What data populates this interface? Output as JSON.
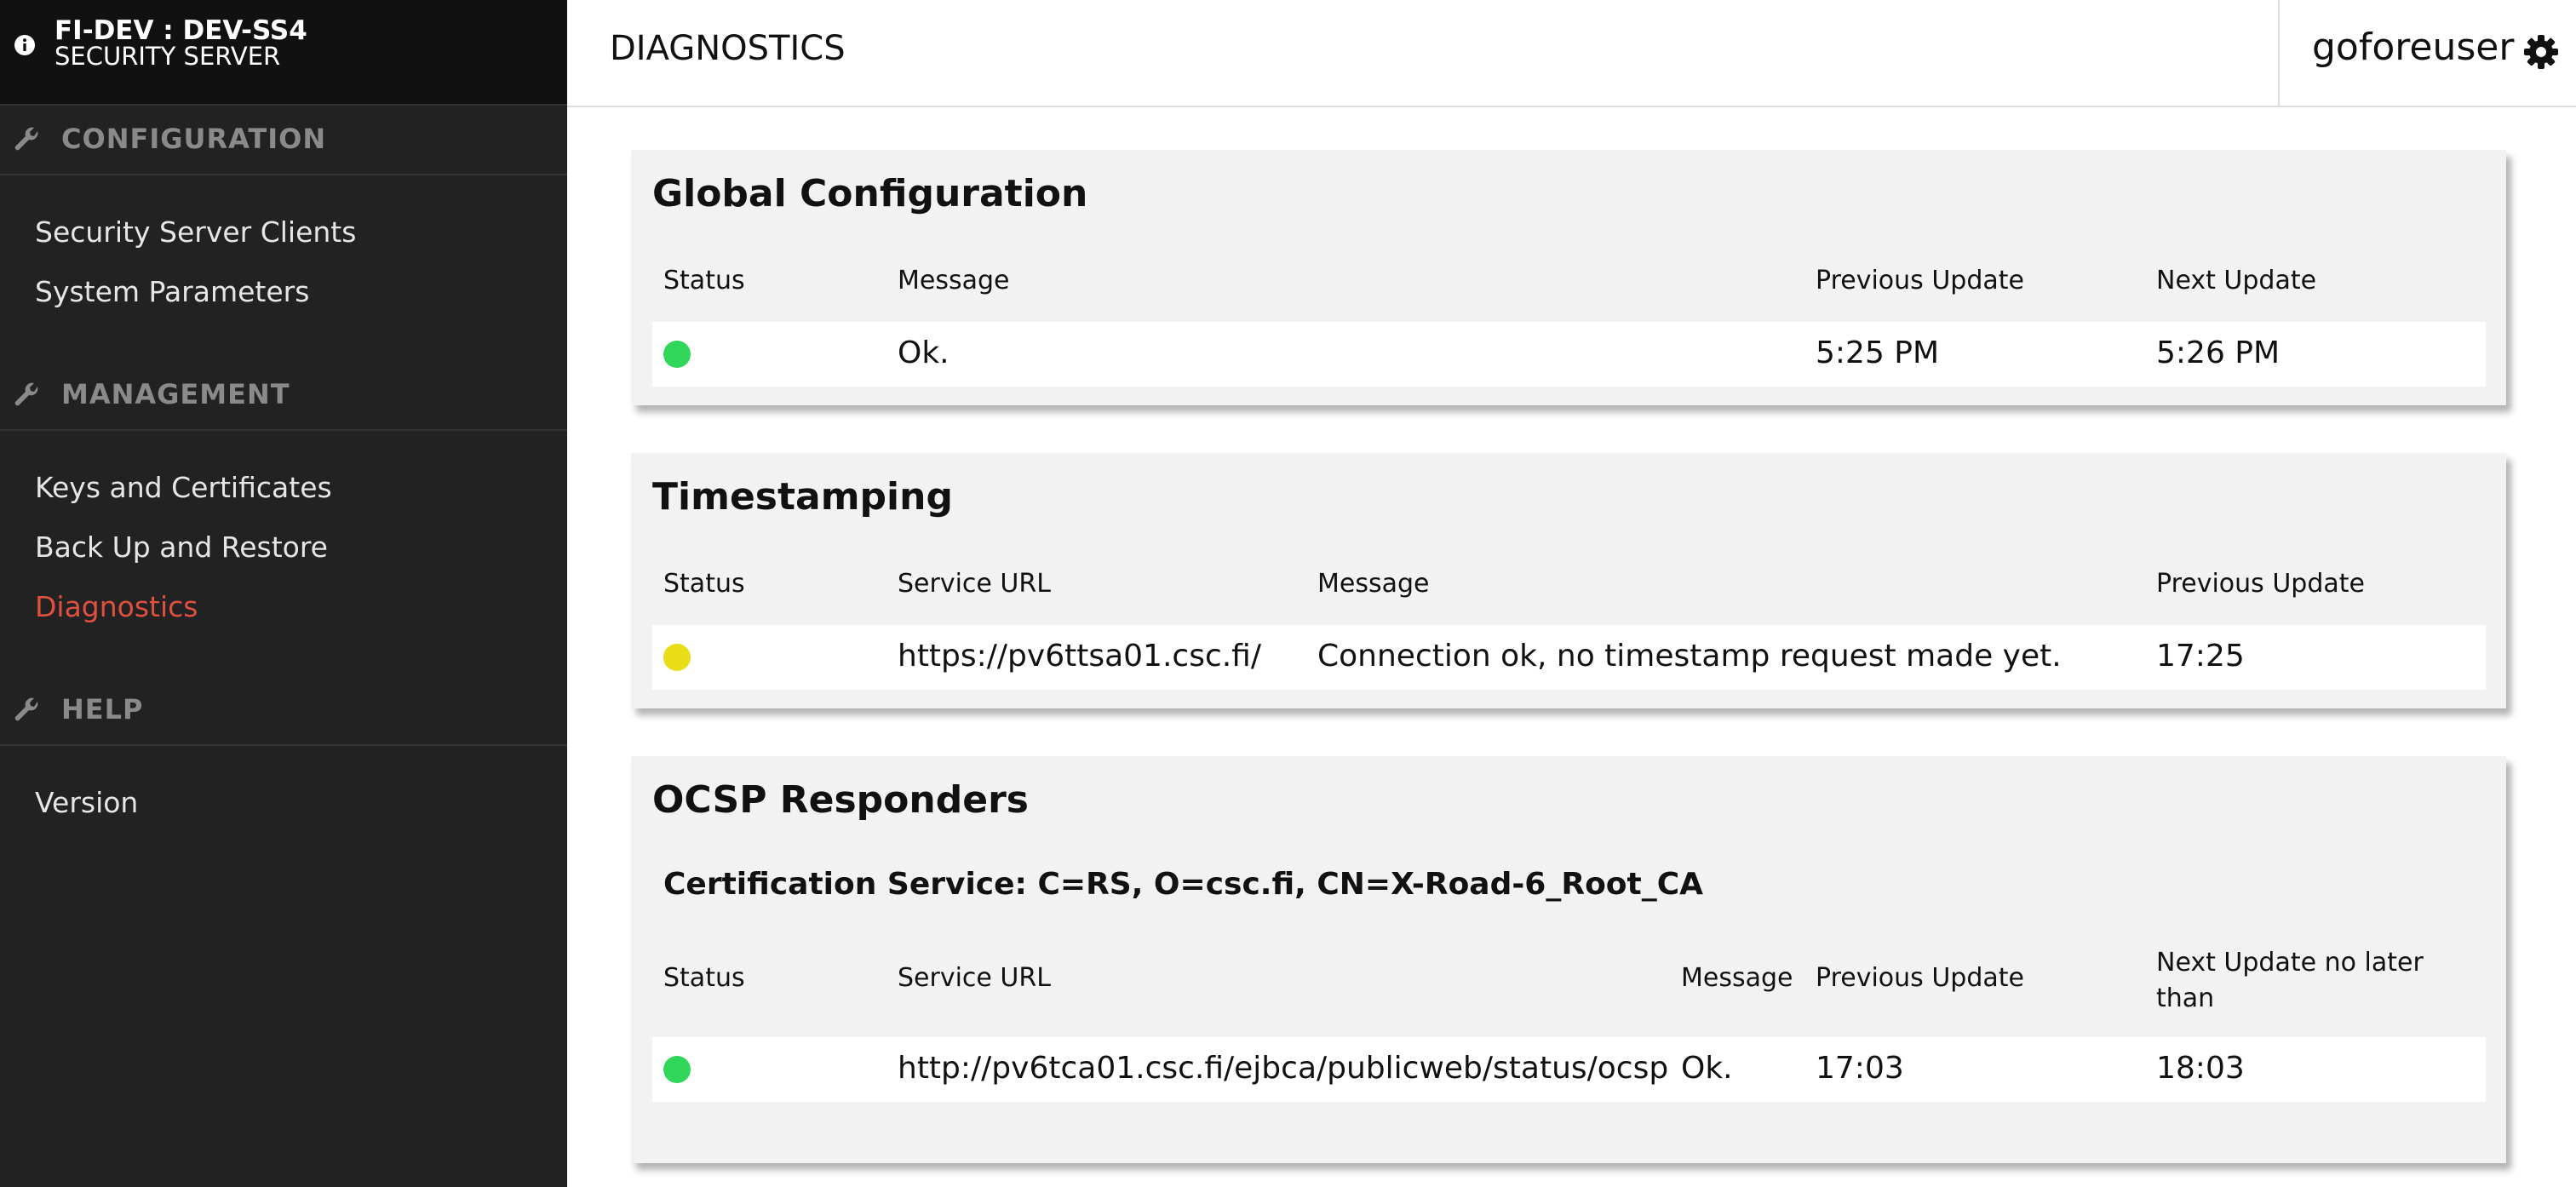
{
  "brand": {
    "line1": "FI-DEV : DEV-SS4",
    "line2": "SECURITY SERVER"
  },
  "sidebar": {
    "sections": [
      {
        "title": "CONFIGURATION",
        "items": [
          "Security Server Clients",
          "System Parameters"
        ]
      },
      {
        "title": "MANAGEMENT",
        "items": [
          "Keys and Certificates",
          "Back Up and Restore",
          "Diagnostics"
        ]
      },
      {
        "title": "HELP",
        "items": [
          "Version"
        ]
      }
    ],
    "active_item": "Diagnostics"
  },
  "header": {
    "title": "DIAGNOSTICS",
    "user": "goforeuser"
  },
  "global_configuration": {
    "title": "Global Configuration",
    "columns": [
      "Status",
      "Message",
      "Previous Update",
      "Next Update"
    ],
    "rows": [
      {
        "status": "green",
        "message": "Ok.",
        "previous_update": "5:25 PM",
        "next_update": "5:26 PM"
      }
    ]
  },
  "timestamping": {
    "title": "Timestamping",
    "columns": [
      "Status",
      "Service URL",
      "Message",
      "Previous Update"
    ],
    "rows": [
      {
        "status": "yellow",
        "service_url": "https://pv6ttsa01.csc.fi/",
        "message": "Connection ok, no timestamp request made yet.",
        "previous_update": "17:25"
      }
    ]
  },
  "ocsp": {
    "title": "OCSP Responders",
    "certification_service": "Certification Service: C=RS, O=csc.fi, CN=X-Road-6_Root_CA",
    "columns": [
      "Status",
      "Service URL",
      "Message",
      "Previous Update",
      "Next Update no later than"
    ],
    "rows": [
      {
        "status": "green",
        "service_url": "http://pv6tca01.csc.fi/ejbca/publicweb/status/ocsp",
        "message": "Ok.",
        "previous_update": "17:03",
        "next_update": "18:03"
      }
    ]
  },
  "colors": {
    "green": "#2fd65a",
    "yellow": "#e8dd16",
    "active_nav": "#e0503f"
  }
}
